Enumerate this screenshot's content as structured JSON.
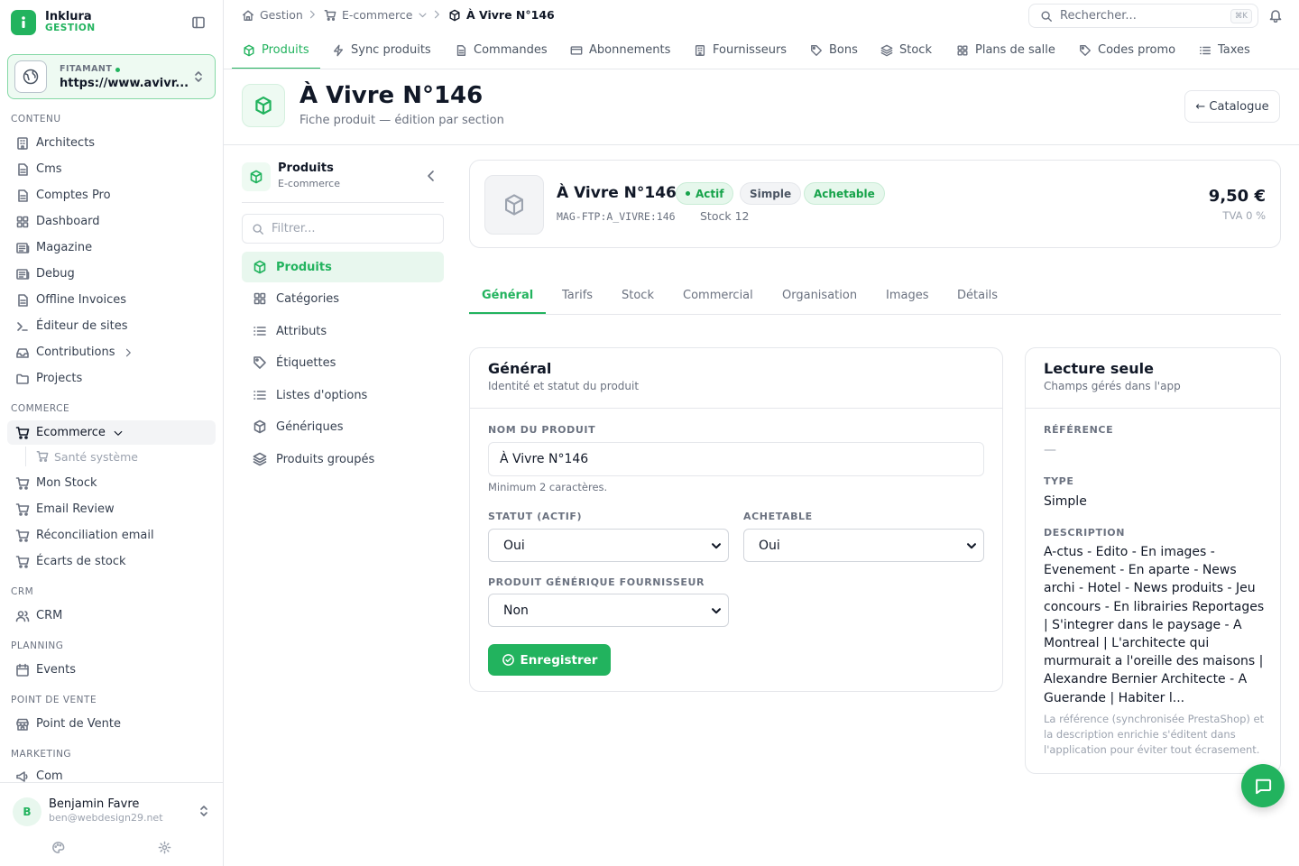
{
  "brand": {
    "name": "Inklura",
    "subtitle": "GESTION"
  },
  "workspace": {
    "label": "FITAMANT",
    "url": "https://www.avivr..."
  },
  "sidebar": {
    "sections": {
      "contenu": "CONTENU",
      "commerce": "COMMERCE",
      "crm": "CRM",
      "planning": "PLANNING",
      "pos": "POINT DE VENTE",
      "marketing": "MARKETING"
    },
    "items": [
      {
        "label": "Architects",
        "icon": "building-icon"
      },
      {
        "label": "Cms",
        "icon": "file-icon"
      },
      {
        "label": "Comptes Pro",
        "icon": "file-icon"
      },
      {
        "label": "Dashboard",
        "icon": "grid-icon"
      },
      {
        "label": "Magazine",
        "icon": "newspaper-icon"
      },
      {
        "label": "Debug",
        "icon": "newspaper-icon"
      },
      {
        "label": "Offline Invoices",
        "icon": "file-icon"
      },
      {
        "label": "Éditeur de sites",
        "icon": "terminal-icon"
      },
      {
        "label": "Contributions",
        "icon": "inbox-icon"
      },
      {
        "label": "Projects",
        "icon": "folder-icon"
      },
      {
        "label": "Ecommerce",
        "icon": "cart-icon"
      },
      {
        "label": "Santé système",
        "icon": "cart-icon"
      },
      {
        "label": "Mon Stock",
        "icon": "cart-icon"
      },
      {
        "label": "Email Review",
        "icon": "cart-icon"
      },
      {
        "label": "Réconciliation email",
        "icon": "cart-icon"
      },
      {
        "label": "Écarts de stock",
        "icon": "cart-icon"
      },
      {
        "label": "CRM",
        "icon": "users-icon"
      },
      {
        "label": "Events",
        "icon": "calendar-icon"
      },
      {
        "label": "Point de Vente",
        "icon": "store-icon"
      },
      {
        "label": "Com",
        "icon": "megaphone-icon"
      }
    ]
  },
  "user": {
    "initial": "B",
    "name": "Benjamin Favre",
    "email": "ben@webdesign29.net"
  },
  "breadcrumb": {
    "home": "Gestion",
    "section": "E-commerce",
    "current": "À Vivre N°146"
  },
  "search": {
    "placeholder": "Rechercher...",
    "shortcut": "⌘K"
  },
  "module_tabs": [
    "Produits",
    "Sync produits",
    "Commandes",
    "Abonnements",
    "Fournisseurs",
    "Bons",
    "Stock",
    "Plans de salle",
    "Codes promo",
    "Taxes"
  ],
  "page": {
    "title": "À Vivre N°146",
    "subtitle": "Fiche produit — édition par section",
    "back_button": "← Catalogue"
  },
  "subpanel": {
    "title": "Produits",
    "subtitle": "E-commerce",
    "filter_placeholder": "Filtrer...",
    "items": [
      "Produits",
      "Catégories",
      "Attributs",
      "Étiquettes",
      "Listes d'options",
      "Génériques",
      "Produits groupés"
    ]
  },
  "product": {
    "name": "À Vivre N°146",
    "status_badge": "Actif",
    "type_badge": "Simple",
    "purchasable_badge": "Achetable",
    "sku": "MAG-FTP:A_VIVRE:146",
    "stock": "Stock 12",
    "price": "9,50 €",
    "vat": "TVA 0 %"
  },
  "section_tabs": [
    "Général",
    "Tarifs",
    "Stock",
    "Commercial",
    "Organisation",
    "Images",
    "Détails"
  ],
  "general_form": {
    "title": "Général",
    "subtitle": "Identité et statut du produit",
    "name_label": "NOM DU PRODUIT",
    "name_value": "À Vivre N°146",
    "name_hint": "Minimum 2 caractères.",
    "status_label": "STATUT (ACTIF)",
    "status_value": "Oui",
    "purchasable_label": "ACHETABLE",
    "purchasable_value": "Oui",
    "generic_label": "PRODUIT GÉNÉRIQUE FOURNISSEUR",
    "generic_value": "Non",
    "save_button": "Enregistrer"
  },
  "readonly": {
    "title": "Lecture seule",
    "subtitle": "Champs gérés dans l'app",
    "ref_label": "RÉFÉRENCE",
    "ref_value": "—",
    "type_label": "TYPE",
    "type_value": "Simple",
    "desc_label": "DESCRIPTION",
    "desc_value": "A-ctus - Edito - En images - Evenement - En aparte - News archi - Hotel - News produits - Jeu concours - En librairies Reportages | S'integrer dans le paysage - A Montreal | L'architecte qui murmurait a l'oreille des maisons | Alexandre Bernier Architecte - A Guerande | Habiter l...",
    "note": "La référence (synchronisée PrestaShop) et la description enrichie s'éditent dans l'application pour éviter tout écrasement."
  },
  "colors": {
    "accent": "#22b35e",
    "accent_soft": "#e8f7ee",
    "border": "#e5e7eb"
  }
}
